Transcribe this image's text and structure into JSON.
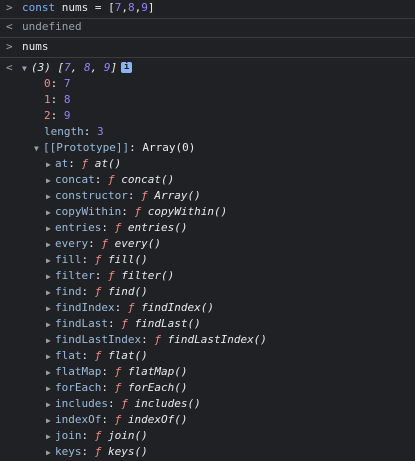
{
  "console": {
    "input1": {
      "keyword": "const",
      "rest": " nums = ",
      "open": "[",
      "v1": "7",
      "c1": ",",
      "v2": "8",
      "c2": ",",
      "v3": "9",
      "close": "]"
    },
    "output1": "undefined",
    "input2": "nums",
    "array_preview": {
      "count": "(3)",
      "open": "[",
      "v1": "7",
      "c1": ", ",
      "v2": "8",
      "c2": ", ",
      "v3": "9",
      "close": "]",
      "info_badge": "i"
    },
    "entries": [
      {
        "key": "0",
        "value": "7"
      },
      {
        "key": "1",
        "value": "8"
      },
      {
        "key": "2",
        "value": "9"
      }
    ],
    "length": {
      "key": "length",
      "value": "3"
    },
    "prototype": {
      "key": "[[Prototype]]",
      "value": "Array(0)"
    },
    "methods": [
      {
        "name": "at",
        "sig": "at()"
      },
      {
        "name": "concat",
        "sig": "concat()"
      },
      {
        "name": "constructor",
        "sig": "Array()"
      },
      {
        "name": "copyWithin",
        "sig": "copyWithin()"
      },
      {
        "name": "entries",
        "sig": "entries()"
      },
      {
        "name": "every",
        "sig": "every()"
      },
      {
        "name": "fill",
        "sig": "fill()"
      },
      {
        "name": "filter",
        "sig": "filter()"
      },
      {
        "name": "find",
        "sig": "find()"
      },
      {
        "name": "findIndex",
        "sig": "findIndex()"
      },
      {
        "name": "findLast",
        "sig": "findLast()"
      },
      {
        "name": "findLastIndex",
        "sig": "findLastIndex()"
      },
      {
        "name": "flat",
        "sig": "flat()"
      },
      {
        "name": "flatMap",
        "sig": "flatMap()"
      },
      {
        "name": "forEach",
        "sig": "forEach()"
      },
      {
        "name": "includes",
        "sig": "includes()"
      },
      {
        "name": "indexOf",
        "sig": "indexOf()"
      },
      {
        "name": "join",
        "sig": "join()"
      },
      {
        "name": "keys",
        "sig": "keys()"
      }
    ],
    "symbols": {
      "prompt": ">",
      "result": "<",
      "expanded": "▼",
      "collapsed": "▶",
      "function_marker": "ƒ",
      "colon": ":"
    },
    "colors": {
      "background": "#202124",
      "keyword": "#7cacf8",
      "number": "#9980ff",
      "property_key": "#9bbbdc",
      "method_name": "#f28b82",
      "muted": "#9aa0a6"
    }
  }
}
